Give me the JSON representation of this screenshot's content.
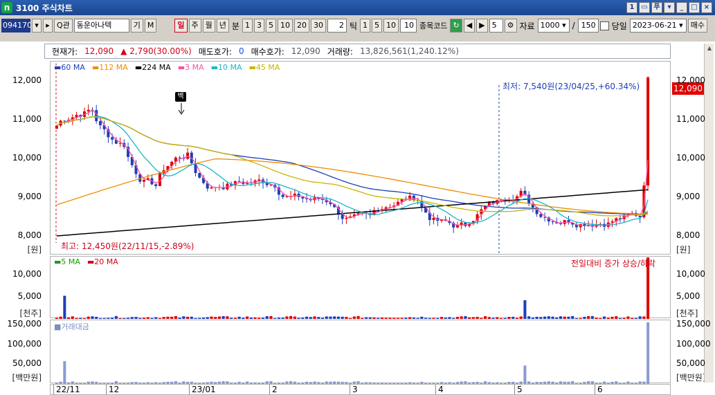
{
  "window": {
    "app_icon": "n",
    "title": "3100 주식차트",
    "buttons": [
      "1",
      "▭",
      "푸",
      "▾",
      "_",
      "□",
      "×"
    ]
  },
  "toolbar": {
    "code": "094170",
    "search_btn": "Q관",
    "name": "동운아나텍",
    "gi": "기",
    "m": "M",
    "periods": [
      "일",
      "주",
      "월",
      "년"
    ],
    "minute_label": "분",
    "minutes": [
      "1",
      "3",
      "5",
      "10",
      "20",
      "30"
    ],
    "tick_value": "2",
    "tick_label": "틱",
    "ticks": [
      "1",
      "5",
      "10"
    ],
    "tick_custom": "10",
    "stock_code_label": "종목코드",
    "step": "5",
    "data_label": "자료",
    "data_count": "1000",
    "slash": "/",
    "display_count": "150",
    "today_label": "당일",
    "date": "2023-06-21",
    "trade_btn": "매수"
  },
  "info": {
    "price_label": "현재가:",
    "price": "12,090",
    "change": "2,790(30.00%)",
    "ask_label": "매도호가:",
    "ask": "0",
    "bid_label": "매수호가:",
    "bid": "12,090",
    "volume_label": "거래량:",
    "volume": "13,826,561(1,240.12%)"
  },
  "price_panel": {
    "legend": [
      {
        "name": "60 MA",
        "color": "#1d3fb8"
      },
      {
        "name": "112 MA",
        "color": "#f08c00"
      },
      {
        "name": "224 MA",
        "color": "#000000"
      },
      {
        "name": "3 MA",
        "color": "#ff4fa3"
      },
      {
        "name": "10 MA",
        "color": "#17b6c9"
      },
      {
        "name": "45 MA",
        "color": "#c9b400"
      }
    ],
    "y_labels": [
      "12,000",
      "11,000",
      "10,000",
      "9,000",
      "8,000"
    ],
    "y_unit": "[원]",
    "current_price_tag": "12,090",
    "low_annotation": "최저: 7,540원(23/04/25,+60.34%)",
    "high_annotation": "최고: 12,450원(22/11/15,-2.89%)",
    "marker_label": "백"
  },
  "volume_panel": {
    "legend": [
      {
        "name": "5 MA",
        "color": "#1aa000"
      },
      {
        "name": "20 MA",
        "color": "#d0021b"
      }
    ],
    "note": "전일대비 증가 상승/하락",
    "y_labels": [
      "10,000",
      "5,000"
    ],
    "y_unit": "[천주]"
  },
  "amount_panel": {
    "legend": "거래대금",
    "y_labels": [
      "150,000",
      "100,000",
      "50,000"
    ],
    "y_unit": "[백만원]"
  },
  "x_axis": [
    "22/11",
    "12",
    "23/01",
    "2",
    "3",
    "4",
    "5",
    "6"
  ],
  "chart_data": {
    "type": "candlestick",
    "price_axis": {
      "min": 7500,
      "max": 12500
    },
    "annotations": {
      "high": 12450,
      "low": 7540,
      "current": 12090
    },
    "volume_axis_max_thousand": 14000,
    "amount_axis_max_million": 160000
  }
}
